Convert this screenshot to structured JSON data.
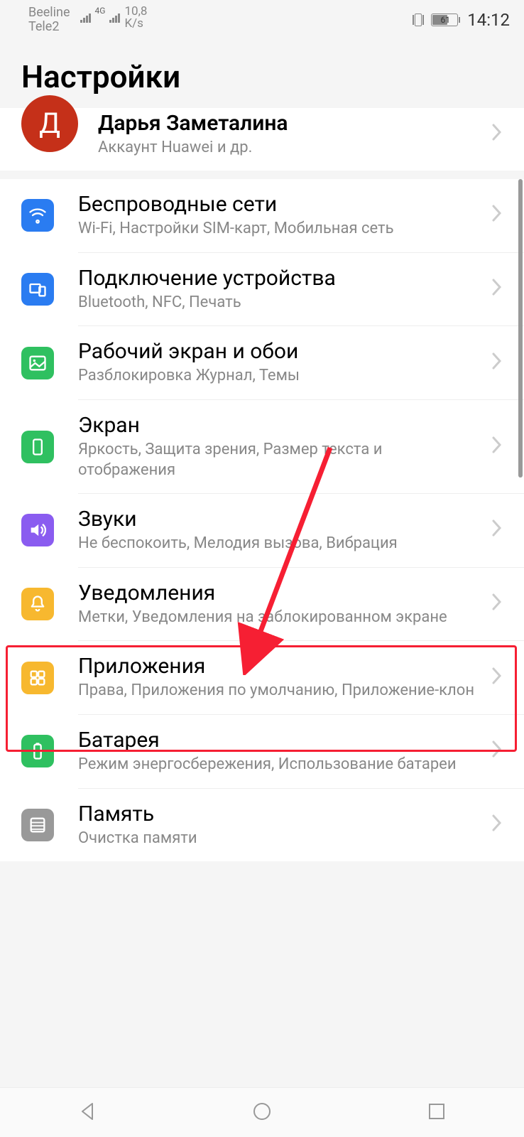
{
  "status": {
    "carrier1": "Beeline",
    "carrier2": "Tele2",
    "net_type": "4G",
    "speed_val": "10,8",
    "speed_unit": "K/s",
    "battery_pct": "61",
    "time": "14:12"
  },
  "title": "Настройки",
  "account": {
    "avatar_initial": "Д",
    "name": "Дарья Заметалина",
    "sub": "Аккаунт Huawei и др."
  },
  "items": [
    {
      "title": "Беспроводные сети",
      "sub": "Wi-Fi, Настройки SIM-карт, Мобильная сеть"
    },
    {
      "title": "Подключение устройства",
      "sub": "Bluetooth, NFC, Печать"
    },
    {
      "title": "Рабочий экран и обои",
      "sub": "Разблокировка Журнал, Темы"
    },
    {
      "title": "Экран",
      "sub": "Яркость, Защита зрения, Размер текста и отображения"
    },
    {
      "title": "Звуки",
      "sub": "Не беспокоить, Мелодия вызова, Вибрация"
    },
    {
      "title": "Уведомления",
      "sub": "Метки, Уведомления на заблокированном экране"
    },
    {
      "title": "Приложения",
      "sub": "Права, Приложения по умолчанию, Приложение-клон"
    },
    {
      "title": "Батарея",
      "sub": "Режим энергосбережения, Использование батареи"
    },
    {
      "title": "Память",
      "sub": "Очистка памяти"
    }
  ]
}
